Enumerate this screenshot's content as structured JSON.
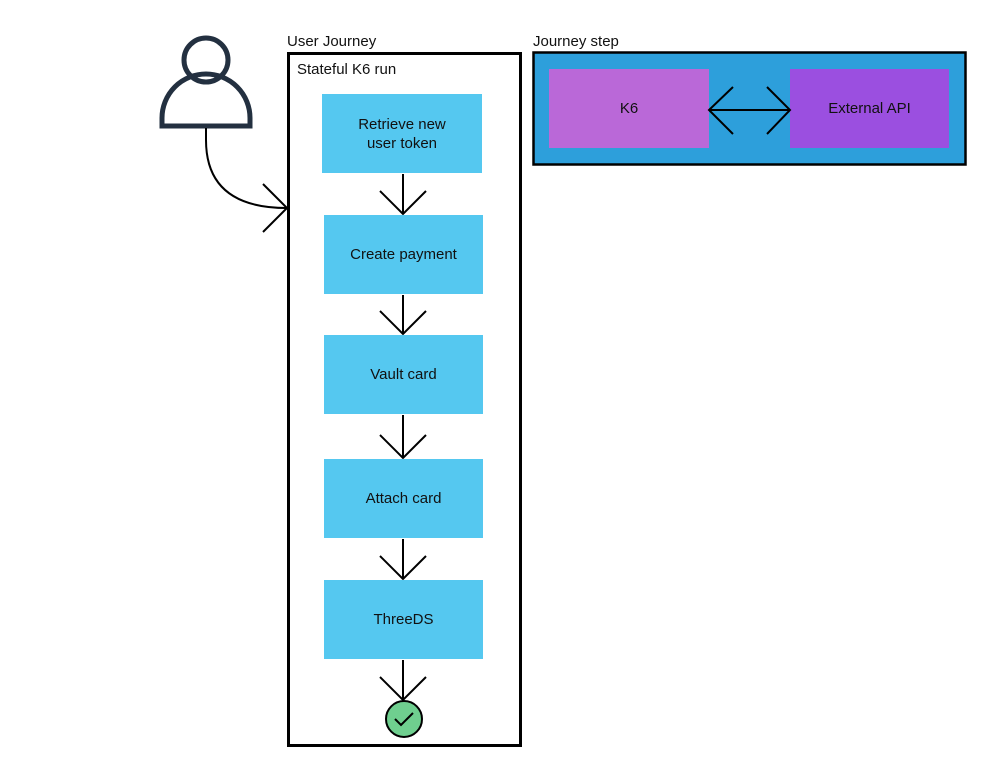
{
  "colors": {
    "step": "#55c8f0",
    "journey_step_bg": "#2d9fdb",
    "k6": "#ba68d8",
    "external_api": "#9b4fe0",
    "done": "#6fcf8f",
    "outline": "#233040"
  },
  "user_journey": {
    "title": "User Journey",
    "container_label": "Stateful K6 run",
    "steps": [
      {
        "label": "Retrieve new user token"
      },
      {
        "label": "Create payment"
      },
      {
        "label": "Vault card"
      },
      {
        "label": "Attach card"
      },
      {
        "label": "ThreeDS"
      }
    ],
    "end_icon": "check-circle-icon"
  },
  "legend": {
    "title": "Journey step",
    "k6": "K6",
    "external_api": "External API"
  },
  "actor_icon": "user-icon"
}
